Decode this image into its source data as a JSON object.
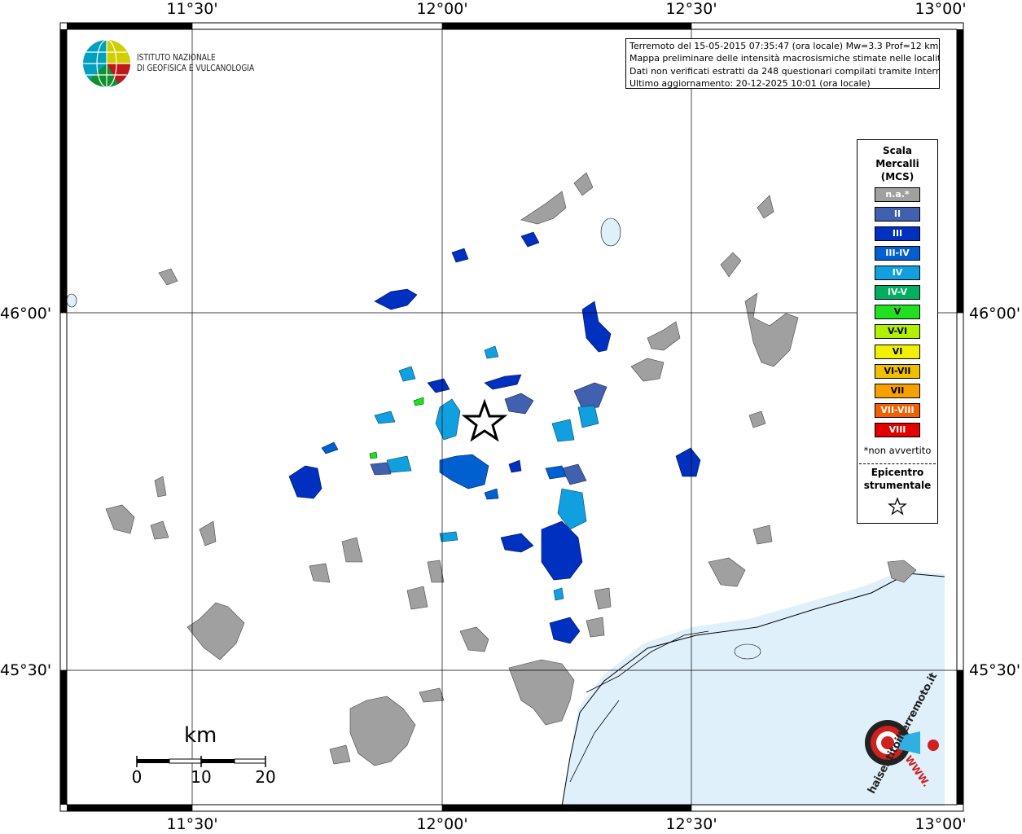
{
  "coords": {
    "top": [
      "11°30'",
      "12°00'",
      "12°30'",
      "13°00'"
    ],
    "bottom": [
      "11°30'",
      "12°00'",
      "12°30'",
      "13°00'"
    ],
    "left": [
      "46°00'",
      "45°30'"
    ],
    "right": [
      "46°00'",
      "45°30'"
    ]
  },
  "logo": {
    "line1": "ISTITUTO NAZIONALE",
    "line2": "DI GEOFISICA E VULCANOLOGIA"
  },
  "info": {
    "line1": "Terremoto del 15-05-2015 07:35:47 (ora locale) Mw=3.3 Prof=12 km",
    "line2": "Mappa preliminare delle intensità macrosismiche stimate nelle località",
    "line3": "Dati non verificati estratti da 248 questionari compilati tramite Internet.",
    "line4": "Ultimo aggiornamento: 20-12-2025 10:01 (ora locale)"
  },
  "legend": {
    "title": [
      "Scala",
      "Mercalli",
      "(MCS)"
    ],
    "items": [
      {
        "label": "n.a.*",
        "color": "#a0a0a0"
      },
      {
        "label": "II",
        "color": "#4060b0"
      },
      {
        "label": "III",
        "color": "#0030c0"
      },
      {
        "label": "III-IV",
        "color": "#0060d0"
      },
      {
        "label": "IV",
        "color": "#10a0e0"
      },
      {
        "label": "IV-V",
        "color": "#00b060"
      },
      {
        "label": "V",
        "color": "#20e020"
      },
      {
        "label": "V-VI",
        "color": "#b0f000"
      },
      {
        "label": "VI",
        "color": "#f0f000"
      },
      {
        "label": "VI-VII",
        "color": "#f0c000"
      },
      {
        "label": "VII",
        "color": "#f8a000"
      },
      {
        "label": "VII-VIII",
        "color": "#f06000"
      },
      {
        "label": "VIII",
        "color": "#e00000"
      }
    ],
    "note": "*non avvertito",
    "epicentre_line1": "Epicentro",
    "epicentre_line2": "strumentale"
  },
  "scale": {
    "unit": "km",
    "labels": [
      "0",
      "10",
      "20"
    ]
  },
  "brand": {
    "text": "haisentitoilterremoto.it",
    "url": "WWW."
  },
  "colors": {
    "sea": "#dff0fb",
    "grey": "#a0a0a0",
    "ii": "#4060b0",
    "iii": "#0030c0",
    "iiiiv": "#0060d0",
    "iv": "#10a0e0",
    "v": "#20e020"
  }
}
